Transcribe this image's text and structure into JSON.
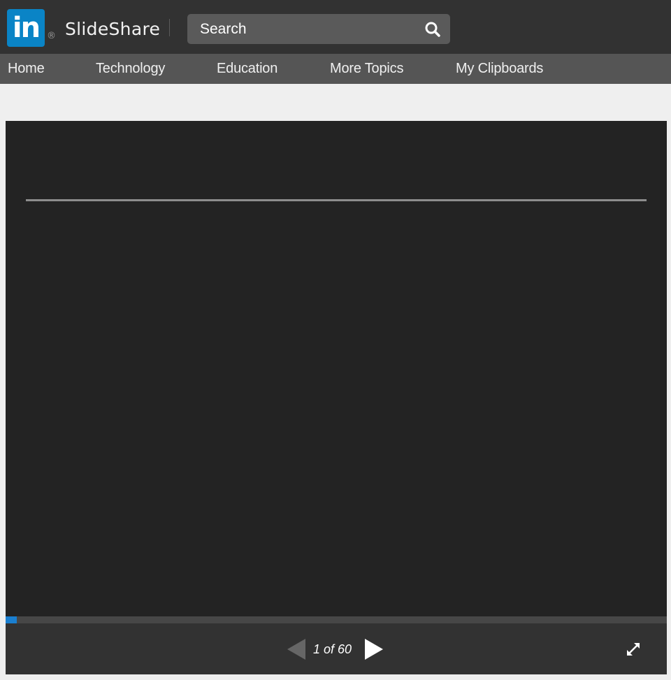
{
  "header": {
    "logo_text": "in",
    "registered_mark": "®",
    "brand_name": "SlideShare",
    "search_placeholder": "Search",
    "icons": {
      "search": "search-icon"
    }
  },
  "nav": {
    "items": [
      {
        "label": "Home"
      },
      {
        "label": "Technology"
      },
      {
        "label": "Education"
      },
      {
        "label": "More Topics"
      },
      {
        "label": "My Clipboards"
      }
    ]
  },
  "player": {
    "current_page": 1,
    "total_pages": 60,
    "page_label": "1 of 60",
    "progress_fraction": 0.0167,
    "icons": {
      "prev": "triangle-left-icon",
      "next": "triangle-right-icon",
      "fullscreen": "expand-icon"
    }
  },
  "colors": {
    "header_bg": "#323232",
    "nav_bg": "#555555",
    "logo_bg": "#0a84c6",
    "player_bg": "#232323",
    "progress_fill": "#1a7fd0"
  }
}
